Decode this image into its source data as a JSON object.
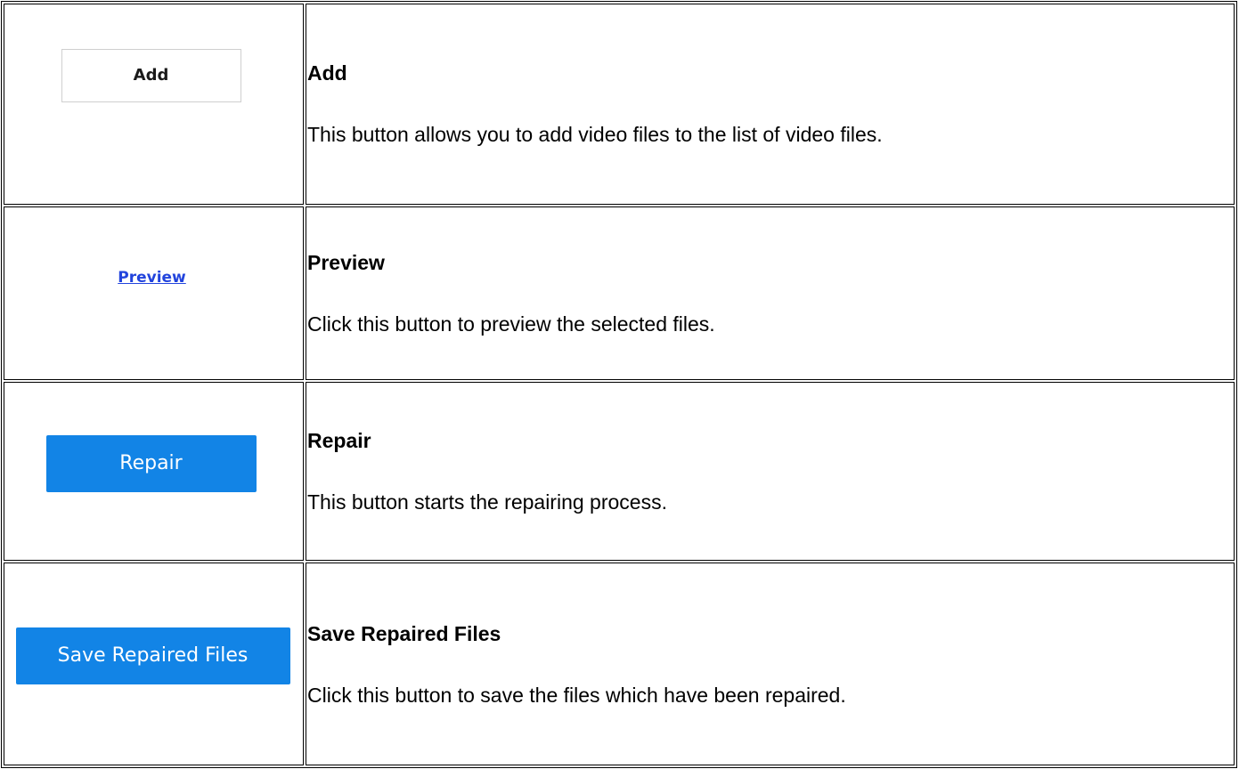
{
  "rows": [
    {
      "control_label": "Add",
      "title": "Add",
      "description": "This button allows you to add video files to the list of video files."
    },
    {
      "control_label": "Preview",
      "title": "Preview",
      "description": "Click this button to preview the selected files."
    },
    {
      "control_label": "Repair",
      "title": "Repair",
      "description": "This button starts the repairing process."
    },
    {
      "control_label": "Save Repaired Files",
      "title": "Save Repaired Files",
      "description": "Click this button to save the files which have been repaired."
    }
  ],
  "colors": {
    "blue_button": "#1284e6",
    "link": "#2244dd",
    "border": "#000000"
  }
}
